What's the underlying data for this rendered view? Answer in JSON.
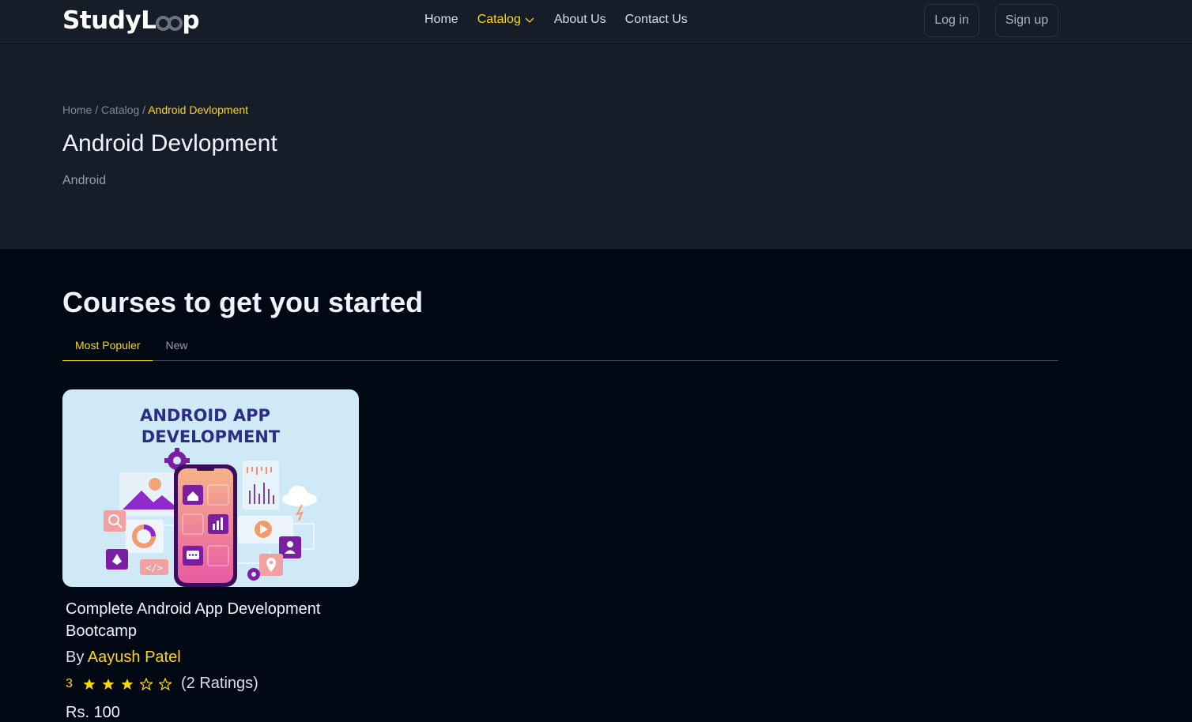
{
  "brand": {
    "name_prefix": "StudyL",
    "name_suffix": "p"
  },
  "nav": {
    "home": "Home",
    "catalog": "Catalog",
    "about": "About Us",
    "contact": "Contact Us"
  },
  "auth": {
    "login": "Log in",
    "signup": "Sign up"
  },
  "breadcrumb": {
    "home": "Home",
    "sep": " / ",
    "catalog": "Catalog",
    "current": "Android Devlopment"
  },
  "hero": {
    "title": "Android Devlopment",
    "description": "Android"
  },
  "courses_section": {
    "title": "Courses to get you started",
    "tabs": [
      "Most Populer",
      "New"
    ],
    "active_tab": "Most Populer"
  },
  "course": {
    "thumbnail_text_line1": "ANDROID APP",
    "thumbnail_text_line2": "DEVELOPMENT",
    "name": "Complete Android App Development Bootcamp",
    "by_label": "By",
    "author": "Aayush Patel",
    "rating": 3,
    "rating_max": 5,
    "rating_count_label": "(2 Ratings)",
    "price": "Rs. 100"
  },
  "colors": {
    "accent": "#ffd60a",
    "bg": "#000814",
    "header_bg": "#161d29"
  }
}
